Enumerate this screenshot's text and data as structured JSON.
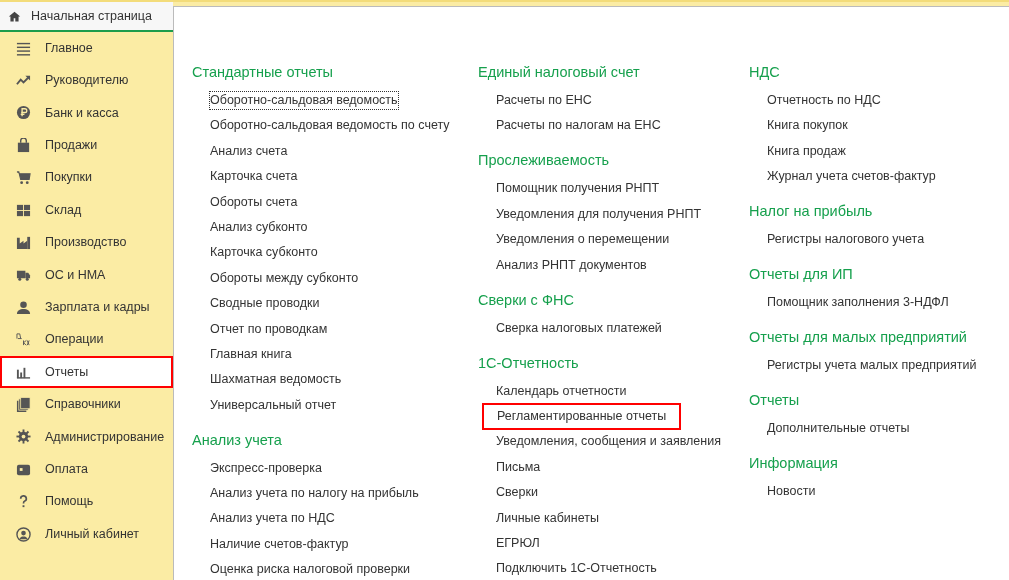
{
  "home_tab": {
    "label": "Начальная страница",
    "selected": true
  },
  "sidebar": {
    "items": [
      {
        "label": "Главное",
        "selected": false
      },
      {
        "label": "Руководителю",
        "selected": false
      },
      {
        "label": "Банк и касса",
        "selected": false
      },
      {
        "label": "Продажи",
        "selected": false
      },
      {
        "label": "Покупки",
        "selected": false
      },
      {
        "label": "Склад",
        "selected": false
      },
      {
        "label": "Производство",
        "selected": false
      },
      {
        "label": "ОС и НМА",
        "selected": false
      },
      {
        "label": "Зарплата и кадры",
        "selected": false
      },
      {
        "label": "Операции",
        "selected": false
      },
      {
        "label": "Отчеты",
        "selected": true
      },
      {
        "label": "Справочники",
        "selected": false
      },
      {
        "label": "Администрирование",
        "selected": false
      },
      {
        "label": "Оплата",
        "selected": false
      },
      {
        "label": "Помощь",
        "selected": false
      },
      {
        "label": "Личный кабинет",
        "selected": false
      }
    ]
  },
  "columns": [
    {
      "sections": [
        {
          "title": "Стандартные отчеты",
          "links": [
            {
              "text": "Оборотно-сальдовая ведомость",
              "focused": true,
              "highlighted": false
            },
            {
              "text": "Оборотно-сальдовая ведомость по счету",
              "focused": false,
              "highlighted": false
            },
            {
              "text": "Анализ счета",
              "focused": false,
              "highlighted": false
            },
            {
              "text": "Карточка счета",
              "focused": false,
              "highlighted": false
            },
            {
              "text": "Обороты счета",
              "focused": false,
              "highlighted": false
            },
            {
              "text": "Анализ субконто",
              "focused": false,
              "highlighted": false
            },
            {
              "text": "Карточка субконто",
              "focused": false,
              "highlighted": false
            },
            {
              "text": "Обороты между субконто",
              "focused": false,
              "highlighted": false
            },
            {
              "text": "Сводные проводки",
              "focused": false,
              "highlighted": false
            },
            {
              "text": "Отчет по проводкам",
              "focused": false,
              "highlighted": false
            },
            {
              "text": "Главная книга",
              "focused": false,
              "highlighted": false
            },
            {
              "text": "Шахматная ведомость",
              "focused": false,
              "highlighted": false
            },
            {
              "text": "Универсальный отчет",
              "focused": false,
              "highlighted": false
            }
          ]
        },
        {
          "title": "Анализ учета",
          "links": [
            {
              "text": "Экспресс-проверка",
              "focused": false,
              "highlighted": false
            },
            {
              "text": "Анализ учета по налогу на прибыль",
              "focused": false,
              "highlighted": false
            },
            {
              "text": "Анализ учета по НДС",
              "focused": false,
              "highlighted": false
            },
            {
              "text": "Наличие счетов-фактур",
              "focused": false,
              "highlighted": false
            },
            {
              "text": "Оценка риска налоговой проверки",
              "focused": false,
              "highlighted": false
            }
          ]
        }
      ]
    },
    {
      "sections": [
        {
          "title": "Единый налоговый счет",
          "links": [
            {
              "text": "Расчеты по ЕНС",
              "focused": false,
              "highlighted": false
            },
            {
              "text": "Расчеты по налогам на ЕНС",
              "focused": false,
              "highlighted": false
            }
          ]
        },
        {
          "title": "Прослеживаемость",
          "links": [
            {
              "text": "Помощник получения РНПТ",
              "focused": false,
              "highlighted": false
            },
            {
              "text": "Уведомления для получения РНПТ",
              "focused": false,
              "highlighted": false
            },
            {
              "text": "Уведомления о перемещении",
              "focused": false,
              "highlighted": false
            },
            {
              "text": "Анализ РНПТ документов",
              "focused": false,
              "highlighted": false
            }
          ]
        },
        {
          "title": "Сверки с ФНС",
          "links": [
            {
              "text": "Сверка налоговых платежей",
              "focused": false,
              "highlighted": false
            }
          ]
        },
        {
          "title": "1С-Отчетность",
          "links": [
            {
              "text": "Календарь отчетности",
              "focused": false,
              "highlighted": false
            },
            {
              "text": "Регламентированные отчеты",
              "focused": false,
              "highlighted": true
            },
            {
              "text": "Уведомления, сообщения и заявления",
              "focused": false,
              "highlighted": false
            },
            {
              "text": "Письма",
              "focused": false,
              "highlighted": false
            },
            {
              "text": "Сверки",
              "focused": false,
              "highlighted": false
            },
            {
              "text": "Личные кабинеты",
              "focused": false,
              "highlighted": false
            },
            {
              "text": "ЕГРЮЛ",
              "focused": false,
              "highlighted": false
            },
            {
              "text": "Подключить 1С-Отчетность",
              "focused": false,
              "highlighted": false
            }
          ]
        }
      ]
    },
    {
      "sections": [
        {
          "title": "НДС",
          "links": [
            {
              "text": "Отчетность по НДС",
              "focused": false,
              "highlighted": false
            },
            {
              "text": "Книга покупок",
              "focused": false,
              "highlighted": false
            },
            {
              "text": "Книга продаж",
              "focused": false,
              "highlighted": false
            },
            {
              "text": "Журнал учета счетов-фактур",
              "focused": false,
              "highlighted": false
            }
          ]
        },
        {
          "title": "Налог на прибыль",
          "links": [
            {
              "text": "Регистры налогового учета",
              "focused": false,
              "highlighted": false
            }
          ]
        },
        {
          "title": "Отчеты для ИП",
          "links": [
            {
              "text": "Помощник заполнения 3-НДФЛ",
              "focused": false,
              "highlighted": false
            }
          ]
        },
        {
          "title": "Отчеты для малых предприятий",
          "links": [
            {
              "text": "Регистры учета малых предприятий",
              "focused": false,
              "highlighted": false
            }
          ]
        },
        {
          "title": "Отчеты",
          "links": [
            {
              "text": "Дополнительные отчеты",
              "focused": false,
              "highlighted": false
            }
          ]
        },
        {
          "title": "Информация",
          "links": [
            {
              "text": "Новости",
              "focused": false,
              "highlighted": false
            }
          ]
        }
      ]
    }
  ]
}
